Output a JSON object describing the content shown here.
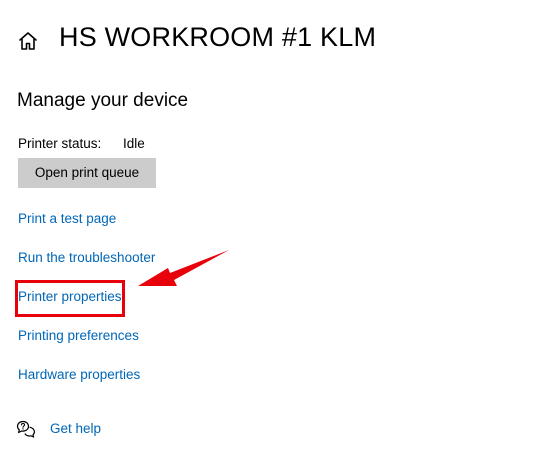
{
  "header": {
    "home_icon": "home-icon",
    "title": "HS WORKROOM #1 KLM"
  },
  "manage": {
    "section_title": "Manage your device",
    "status_label": "Printer status:",
    "status_value": "Idle",
    "queue_button_label": "Open print queue"
  },
  "links": {
    "test_page": "Print a test page",
    "troubleshooter": "Run the troubleshooter",
    "printer_properties": "Printer properties",
    "printing_preferences": "Printing preferences",
    "hardware_properties": "Hardware properties"
  },
  "help": {
    "icon": "chat-help-icon",
    "label": "Get help"
  },
  "colors": {
    "link": "#0067b8",
    "button_bg": "#cccccc",
    "annotation_red": "#e8000b"
  }
}
